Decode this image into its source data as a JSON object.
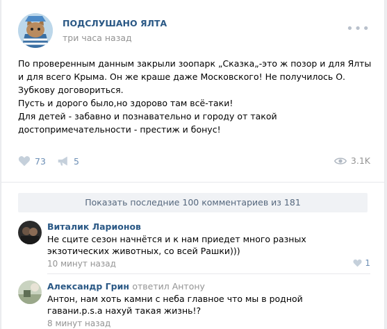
{
  "post": {
    "group_name": "ПОДСЛУШАНО ЯЛТА",
    "time": "три часа назад",
    "more": "•••",
    "text_lines": [
      "По проверенным данным закрыли зоопарк „Сказка„-это ж позор и для Ялты и для всего Крыма. Он же краше даже Московского! Не получилось О. Зубкову договориться.",
      "Пусть и дорого было,но здорово там всё-таки!",
      "Для детей - забавно и познавательно и городу от такой достопримечательности - престиж и бонус!"
    ],
    "likes": "73",
    "shares": "5",
    "views": "3.1K"
  },
  "comments": {
    "show_more_label": "Показать последние 100 комментариев из 181",
    "items": [
      {
        "author": "Виталик Ларионов",
        "reply_to": "",
        "text": "Не сците сезон начнётся и к нам приедет много разных экзотических животных, со всей Рашки)))",
        "time": "10 минут назад",
        "likes": "1"
      },
      {
        "author": "Александр Грин",
        "reply_to": "ответил Антону",
        "text": "Антон, нам хоть камни с неба главное что мы в родной гавани.p.s.a нахуй такая жизнь!?",
        "time": "8 минут назад",
        "likes": ""
      }
    ]
  },
  "colors": {
    "link": "#2a5885",
    "muted": "#939393",
    "action": "#6b8eb5",
    "background": "#edeef0"
  },
  "icons": {
    "like": "heart-icon",
    "share": "megaphone-icon",
    "views": "eye-icon"
  }
}
